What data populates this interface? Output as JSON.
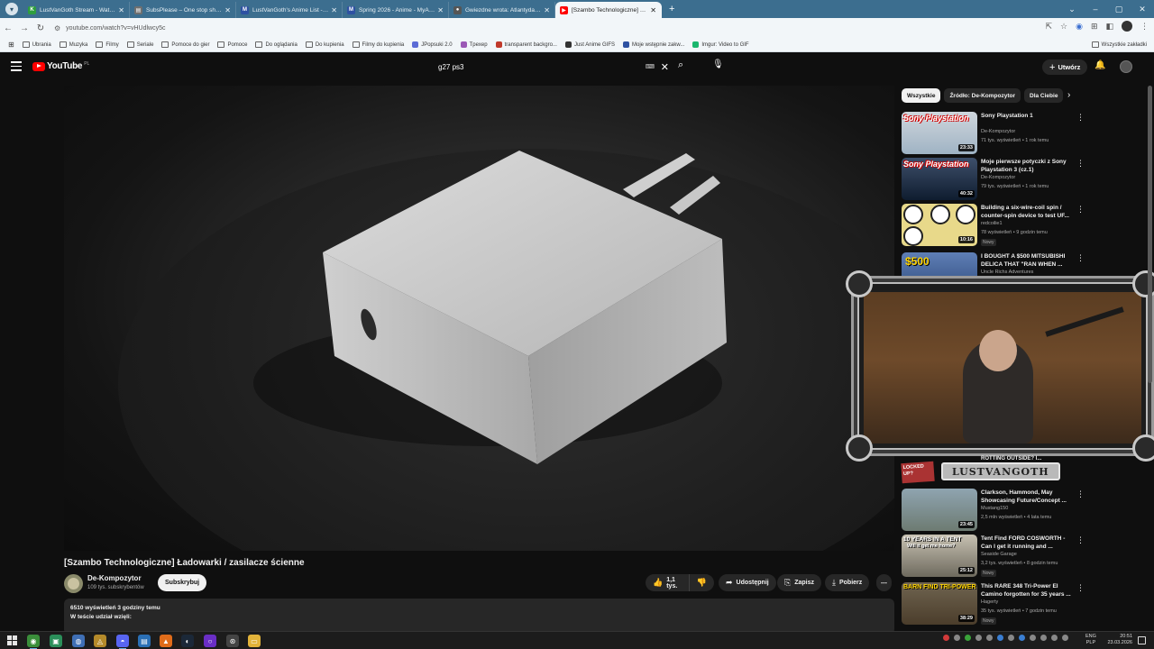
{
  "browser": {
    "tabs": [
      {
        "title": "LustVanGoth Stream - Watch L...",
        "fav_color": "#2e9e3e",
        "fav_glyph": "K"
      },
      {
        "title": "SubsPlease – One stop shop fo...",
        "fav_color": "#6f6f6f",
        "fav_glyph": "▤"
      },
      {
        "title": "LustVanGoth's Anime List - My...",
        "fav_color": "#2e51a2",
        "fav_glyph": "M"
      },
      {
        "title": "Spring 2026 - Anime - MyAnim...",
        "fav_color": "#2e51a2",
        "fav_glyph": "M"
      },
      {
        "title": "Gwiezdne wrota: Atlantyda / St...",
        "fav_color": "#555555",
        "fav_glyph": "●"
      },
      {
        "title": "[Szambo Technologiczne] Łado...",
        "fav_color": "#ff0000",
        "fav_glyph": "▶"
      }
    ],
    "url": "youtube.com/watch?v=vHUdlwcy5c",
    "bookmarks": [
      {
        "label": "Ubrania",
        "kind": "folder"
      },
      {
        "label": "Muzyka",
        "kind": "folder"
      },
      {
        "label": "Filmy",
        "kind": "folder"
      },
      {
        "label": "Seriale",
        "kind": "folder"
      },
      {
        "label": "Pomoce do gier",
        "kind": "folder"
      },
      {
        "label": "Pomoce",
        "kind": "folder"
      },
      {
        "label": "Do oglądania",
        "kind": "folder"
      },
      {
        "label": "Do kupienia",
        "kind": "folder"
      },
      {
        "label": "Filmy do kupienia",
        "kind": "folder"
      },
      {
        "label": "JPopsuki 2.0",
        "kind": "site",
        "color": "#5b6bd6"
      },
      {
        "label": "Tpexep",
        "kind": "site",
        "color": "#9b59b6"
      },
      {
        "label": "transparent backgro...",
        "kind": "site",
        "color": "#c0392b"
      },
      {
        "label": "Just Anime GIFS",
        "kind": "site",
        "color": "#333333"
      },
      {
        "label": "Moje wstępnie zakw...",
        "kind": "site",
        "color": "#2e51a2"
      },
      {
        "label": "Imgur: Video to GIF",
        "kind": "site",
        "color": "#1bb76e"
      }
    ],
    "bookmarks_all": "Wszystkie zakładki"
  },
  "youtube": {
    "logo_text": "YouTube",
    "region": "PL",
    "search_value": "g27 ps3",
    "create_label": "Utwórz"
  },
  "video": {
    "title": "[Szambo Technologiczne] Ładowarki / zasilacze ścienne",
    "channel": "De-Kompozytor",
    "subscribers": "109 tys. subskrybentów",
    "subscribe_label": "Subskrybuj",
    "likes": "1,1 tys.",
    "share_label": "Udostępnij",
    "save_label": "Zapisz",
    "download_label": "Pobierz",
    "meta_line": "6510 wyświetleń  3 godziny temu",
    "desc_line": "W teście udział wzięli:"
  },
  "sidebar": {
    "chips": [
      "Wszystkie",
      "Źródło: De-Kompozytor",
      "Dla Ciebie"
    ],
    "items": [
      {
        "title": "Sony Playstation 1",
        "channel": "De-Kompozytor",
        "meta": "71 tys. wyświetleń • 1 rok temu",
        "duration": "23:33",
        "thumb": "ps1",
        "badge": ""
      },
      {
        "title": "Moje pierwsze potyczki z Sony Playstation 3 (cz.1)",
        "channel": "De-Kompozytor",
        "meta": "79 tys. wyświetleń • 1 rok temu",
        "duration": "40:32",
        "thumb": "ps3",
        "badge": ""
      },
      {
        "title": "Building a six-wire-coil spin / counter-spin device to test UF...",
        "channel": "redcoilie1",
        "meta": "78 wyświetleń • 9 godzin temu",
        "duration": "10:16",
        "thumb": "coil",
        "badge": "Nowy"
      },
      {
        "title": "I BOUGHT A $500 MITSUBISHI DELICA THAT \"RAN WHEN ...",
        "channel": "Uncle Richs Adventures",
        "meta": "",
        "duration": "",
        "thumb": "mitsu",
        "badge": ""
      },
      {
        "title": "Clarkson, Hammond, May Showcasing Future/Concept ...",
        "channel": "Mustang150",
        "meta": "2,5 mln wyświetleń • 4 lata temu",
        "duration": "23:45",
        "thumb": "car1",
        "badge": ""
      },
      {
        "title": "Tent Find FORD COSWORTH - Can I get it running and ...",
        "channel": "Seaside Garage",
        "meta": "3,2 tys. wyświetleń • 8 godzin temu",
        "duration": "25:12",
        "thumb": "car2",
        "badge": "Nowy"
      },
      {
        "title": "This RARE 348 Tri-Power El Camino forgotten for 35 years ...",
        "channel": "Hagerty",
        "meta": "35 tys. wyświetleń • 7 godzin temu",
        "duration": "38:29",
        "thumb": "car3",
        "badge": "Nowy"
      }
    ],
    "mitsu_price": "$500"
  },
  "overlay": {
    "brand": "LUSTVANGOTH",
    "locked": "LOCKED UP?",
    "cut_title": "ROTTING OUTSIDE? I..."
  },
  "thumb_text": {
    "tent": "10 YEARS IN A TENT",
    "tent2": "Will it get me home?",
    "barn": "BARN FIND TRI-POWER"
  },
  "taskbar": {
    "lang_top": "ENG",
    "lang_bottom": "PLP",
    "time": "20:51",
    "date": "23.03.2026"
  }
}
